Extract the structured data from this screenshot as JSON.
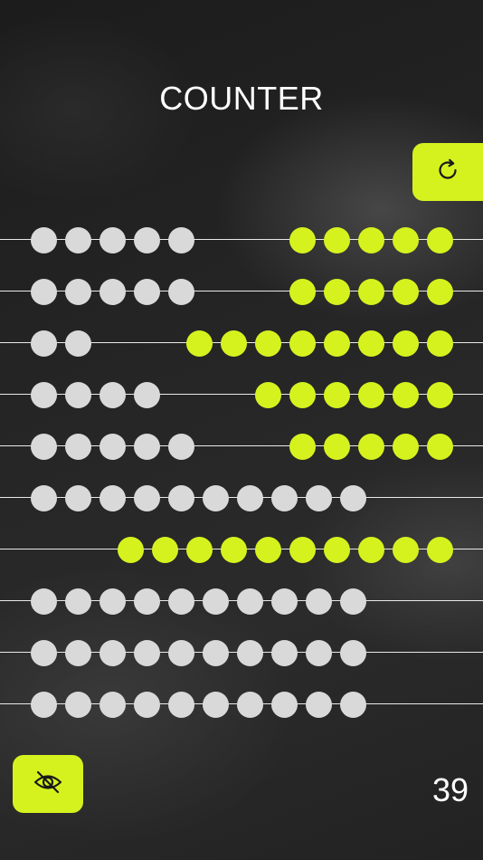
{
  "header": {
    "title": "COUNTER"
  },
  "controls": {
    "reset_icon": "refresh-icon",
    "visibility_icon": "eye-slash-icon"
  },
  "colors": {
    "accent": "#d6f21e",
    "bead_inactive": "#d9d9d9",
    "background": "#222222",
    "text": "#ffffff"
  },
  "abacus": {
    "beads_per_row": 10,
    "rows": [
      {
        "counted": 5
      },
      {
        "counted": 5
      },
      {
        "counted": 8
      },
      {
        "counted": 6
      },
      {
        "counted": 5
      },
      {
        "counted": 0
      },
      {
        "counted": 10
      },
      {
        "counted": 0
      },
      {
        "counted": 0
      },
      {
        "counted": 0
      }
    ]
  },
  "total": "39"
}
